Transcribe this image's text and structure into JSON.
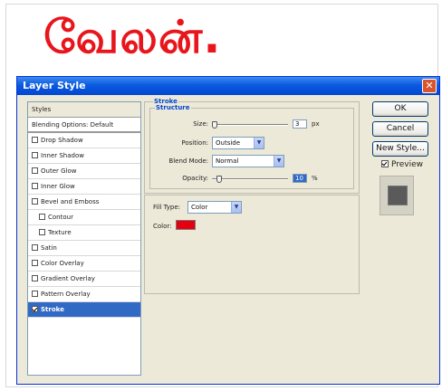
{
  "headline": "வேலன்.",
  "dialog": {
    "title": "Layer Style",
    "close_glyph": "✕"
  },
  "styles_list": [
    {
      "label": "Styles",
      "checkbox": false,
      "checked": false,
      "indent": false,
      "selected": false
    },
    {
      "label": "Blending Options: Default",
      "checkbox": false,
      "checked": false,
      "indent": false,
      "selected": false
    },
    {
      "label": "Drop Shadow",
      "checkbox": true,
      "checked": false,
      "indent": false,
      "selected": false
    },
    {
      "label": "Inner Shadow",
      "checkbox": true,
      "checked": false,
      "indent": false,
      "selected": false
    },
    {
      "label": "Outer Glow",
      "checkbox": true,
      "checked": false,
      "indent": false,
      "selected": false
    },
    {
      "label": "Inner Glow",
      "checkbox": true,
      "checked": false,
      "indent": false,
      "selected": false
    },
    {
      "label": "Bevel and Emboss",
      "checkbox": true,
      "checked": false,
      "indent": false,
      "selected": false
    },
    {
      "label": "Contour",
      "checkbox": true,
      "checked": false,
      "indent": true,
      "selected": false
    },
    {
      "label": "Texture",
      "checkbox": true,
      "checked": false,
      "indent": true,
      "selected": false
    },
    {
      "label": "Satin",
      "checkbox": true,
      "checked": false,
      "indent": false,
      "selected": false
    },
    {
      "label": "Color Overlay",
      "checkbox": true,
      "checked": false,
      "indent": false,
      "selected": false
    },
    {
      "label": "Gradient Overlay",
      "checkbox": true,
      "checked": false,
      "indent": false,
      "selected": false
    },
    {
      "label": "Pattern Overlay",
      "checkbox": true,
      "checked": false,
      "indent": false,
      "selected": false
    },
    {
      "label": "Stroke",
      "checkbox": true,
      "checked": true,
      "indent": false,
      "selected": true
    }
  ],
  "stroke": {
    "group_title": "Stroke",
    "subgroup_title": "Structure",
    "size_label": "Size:",
    "size_value": "3",
    "size_unit": "px",
    "size_slider_fraction": 0.03,
    "position_label": "Position:",
    "position_value": "Outside",
    "blend_mode_label": "Blend Mode:",
    "blend_mode_value": "Normal",
    "opacity_label": "Opacity:",
    "opacity_value": "10",
    "opacity_unit": "%",
    "opacity_slider_fraction": 0.1
  },
  "fill": {
    "fill_type_label": "Fill Type:",
    "fill_type_value": "Color",
    "color_label": "Color:",
    "color_hex": "#e6000f"
  },
  "buttons": {
    "ok": "OK",
    "cancel": "Cancel",
    "new_style": "New Style..."
  },
  "preview": {
    "label": "Preview",
    "checked": true
  },
  "colors": {
    "headline": "#e8161c",
    "title_bar": "#0a5ae0",
    "selected_row": "#316ac5"
  }
}
